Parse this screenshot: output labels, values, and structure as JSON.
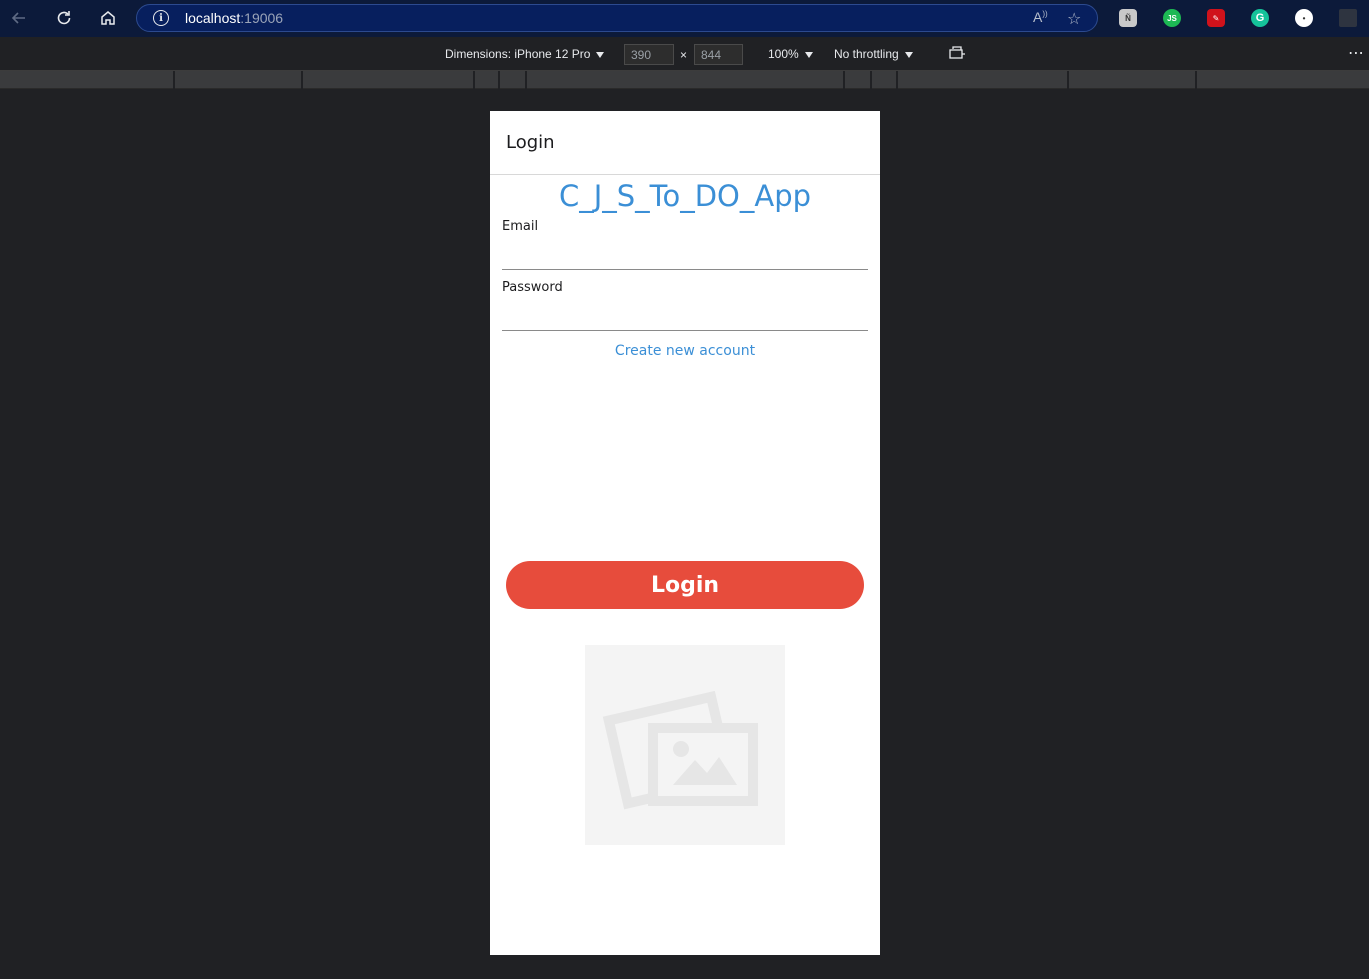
{
  "browser": {
    "url_host": "localhost",
    "url_port": ":19006",
    "icons": [
      "back-icon",
      "reload-icon",
      "home-icon",
      "info-icon",
      "read-aloud-icon",
      "favorites-icon"
    ]
  },
  "device_toolbar": {
    "dimensions_label": "Dimensions: iPhone 12 Pro",
    "width": "390",
    "times": "×",
    "height": "844",
    "zoom": "100%",
    "throttling": "No throttling",
    "more": "⋯"
  },
  "extensions": [
    {
      "name": "Ñ",
      "color": "#c9c9c9"
    },
    {
      "name": "JS",
      "color": "#1db954"
    },
    {
      "name": "✎",
      "color": "#d0121b"
    },
    {
      "name": "G",
      "color": "#15c39a"
    },
    {
      "name": "•",
      "color": "#ffffff"
    }
  ],
  "app": {
    "header_title": "Login",
    "title": "C_J_S_To_DO_App",
    "email_label": "Email",
    "email_value": "",
    "password_label": "Password",
    "password_value": "",
    "create_account_link": "Create new account",
    "login_button": "Login"
  },
  "colors": {
    "accent_blue": "#3b8fd6",
    "login_red": "#e74c3c"
  }
}
